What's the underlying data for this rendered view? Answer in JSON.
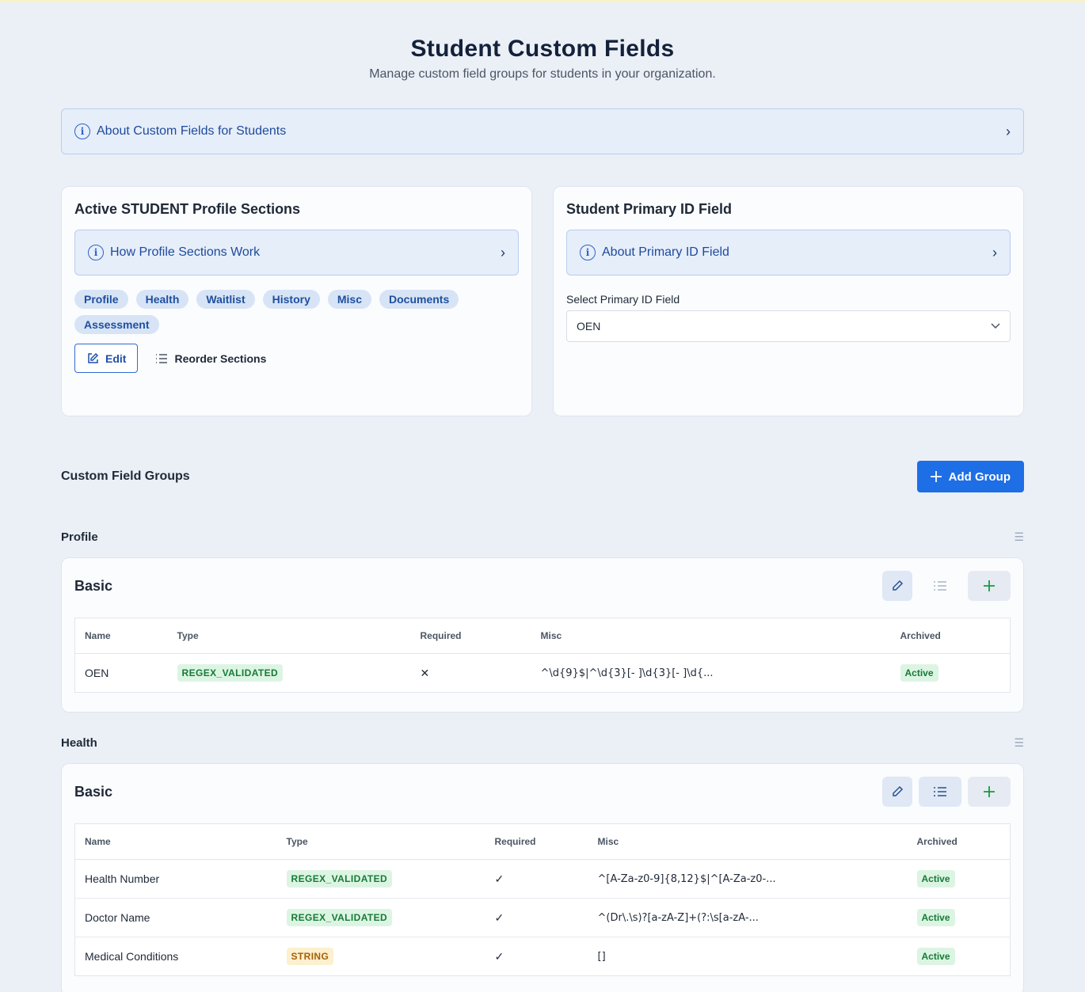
{
  "page": {
    "title": "Student Custom Fields",
    "subtitle": "Manage custom field groups for students in your organization."
  },
  "about_bar": {
    "label": "About Custom Fields for Students"
  },
  "profile_sections": {
    "title": "Active STUDENT Profile Sections",
    "info_label": "How Profile Sections Work",
    "sections": [
      "Profile",
      "Health",
      "Waitlist",
      "History",
      "Misc",
      "Documents",
      "Assessment"
    ],
    "edit_label": "Edit",
    "reorder_label": "Reorder Sections"
  },
  "primary_id": {
    "title": "Student Primary ID Field",
    "info_label": "About Primary ID Field",
    "select_label": "Select Primary ID Field",
    "selected_value": "OEN"
  },
  "groups": {
    "title": "Custom Field Groups",
    "add_label": "Add Group"
  },
  "table_headers": [
    "Name",
    "Type",
    "Required",
    "Misc",
    "Archived"
  ],
  "sections": [
    {
      "title": "Profile",
      "group_name": "Basic",
      "rows": [
        {
          "name": "OEN",
          "type": "REGEX_VALIDATED",
          "required": "✕",
          "misc": "^\\d{9}$|^\\d{3}[- ]\\d{3}[- ]\\d{...",
          "archived": "Active"
        }
      ]
    },
    {
      "title": "Health",
      "group_name": "Basic",
      "rows": [
        {
          "name": "Health Number",
          "type": "REGEX_VALIDATED",
          "required": "✓",
          "misc": "^[A-Za-z0-9]{8,12}$|^[A-Za-z0-...",
          "archived": "Active"
        },
        {
          "name": "Doctor Name",
          "type": "REGEX_VALIDATED",
          "required": "✓",
          "misc": "^(Dr\\.\\s)?[a-zA-Z]+(?:\\s[a-zA-...",
          "archived": "Active"
        },
        {
          "name": "Medical Conditions",
          "type": "STRING",
          "required": "✓",
          "misc": "[]",
          "archived": "Active"
        }
      ]
    }
  ],
  "colors": {
    "primary": "#1e6ee6",
    "success": "#167a36",
    "warning": "#a45f06"
  }
}
